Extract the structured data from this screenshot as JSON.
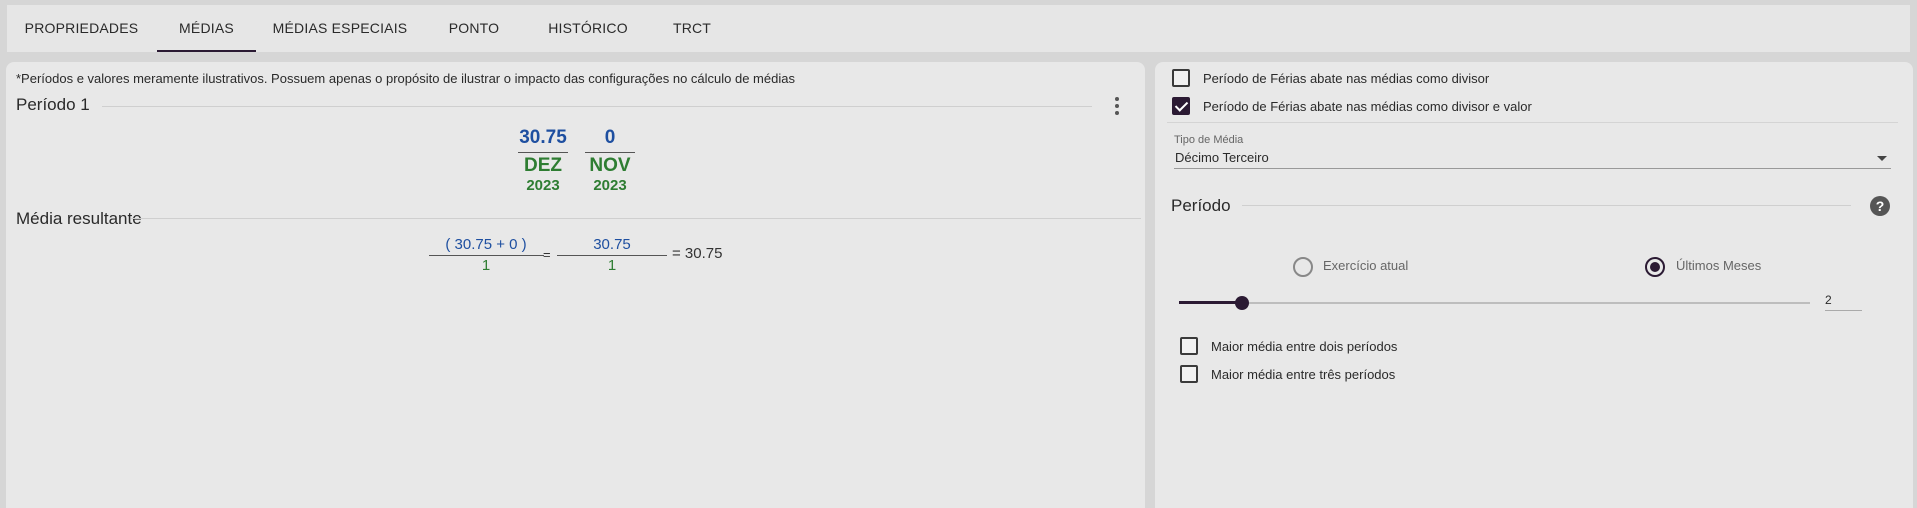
{
  "tabs": [
    {
      "label": "PROPRIEDADES",
      "active": false
    },
    {
      "label": "MÉDIAS",
      "active": true
    },
    {
      "label": "MÉDIAS ESPECIAIS",
      "active": false
    },
    {
      "label": "PONTO",
      "active": false
    },
    {
      "label": "HISTÓRICO",
      "active": false
    },
    {
      "label": "TRCT",
      "active": false
    }
  ],
  "left": {
    "note": "*Períodos e valores meramente ilustrativos. Possuem apenas o propósito de ilustrar o impacto das configurações no cálculo de médias",
    "period_title": "Período 1",
    "months": [
      {
        "value": "30.75",
        "month": "DEZ",
        "year": "2023"
      },
      {
        "value": "0",
        "month": "NOV",
        "year": "2023"
      }
    ],
    "result_title": "Média resultante",
    "formula": {
      "num1": "( 30.75 + 0 )",
      "den1": "1",
      "eq1": "=",
      "num2": "30.75",
      "den2": "1",
      "eq2": "= 30.75"
    }
  },
  "right": {
    "checkboxes_top": [
      {
        "label": "Período de Férias abate nas médias como divisor",
        "checked": false
      },
      {
        "label": "Período de Férias abate nas médias como divisor e valor",
        "checked": true
      }
    ],
    "tipo_media": {
      "label": "Tipo de Média",
      "value": "Décimo Terceiro"
    },
    "period_title": "Período",
    "help_icon": "?",
    "radios": [
      {
        "label": "Exercício atual",
        "selected": false
      },
      {
        "label": "Últimos Meses",
        "selected": true
      }
    ],
    "slider": {
      "value": "2",
      "fraction": 0.1
    },
    "checkboxes_bottom": [
      {
        "label": "Maior média entre dois períodos",
        "checked": false
      },
      {
        "label": "Maior média entre três períodos",
        "checked": false
      }
    ]
  },
  "colors": {
    "accent": "#2b1a33",
    "value_blue": "#1e4fa0",
    "month_green": "#2e7d32"
  }
}
